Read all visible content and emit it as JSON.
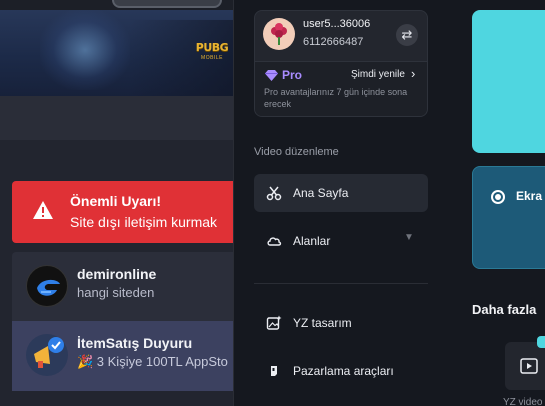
{
  "background_app": {
    "banner": {
      "game_logo": "PUBG",
      "game_logo_sub": "MOBILE"
    },
    "alert": {
      "title": "Önemli Uyarı!",
      "message": "Site dışı iletişim kurmak"
    },
    "cards": [
      {
        "name": "demironline",
        "subtitle": "hangi siteden"
      },
      {
        "name": "İtemSatış Duyuru",
        "subtitle": "🎉 3 Kişiye 100TL AppSto"
      }
    ]
  },
  "drawer": {
    "account": {
      "username": "user5...36006",
      "user_id": "6112666487",
      "plan_label": "Pro",
      "renew_label": "Şimdi yenile",
      "plan_note": "Pro avantajlarınız 7 gün içinde sona erecek"
    },
    "section_title": "Video düzenleme",
    "nav_items": [
      {
        "label": "Ana Sayfa",
        "icon": "scissors-icon",
        "active": true
      },
      {
        "label": "Alanlar",
        "icon": "cloud-icon",
        "active": false,
        "has_dropdown": true
      },
      {
        "label": "YZ tasarım",
        "icon": "ai-image-icon",
        "active": false
      },
      {
        "label": "Pazarlama araçları",
        "icon": "marketing-icon",
        "active": false
      }
    ]
  },
  "right_panel": {
    "option_label": "Ekra",
    "section_title": "Daha fazla",
    "tool_label": "YZ video"
  },
  "colors": {
    "alert_red": "#e03136",
    "pro_purple": "#a98cff",
    "accent_cyan": "#4fd6e0",
    "teal_card": "#1d5a78",
    "drawer_bg": "#15181f"
  }
}
